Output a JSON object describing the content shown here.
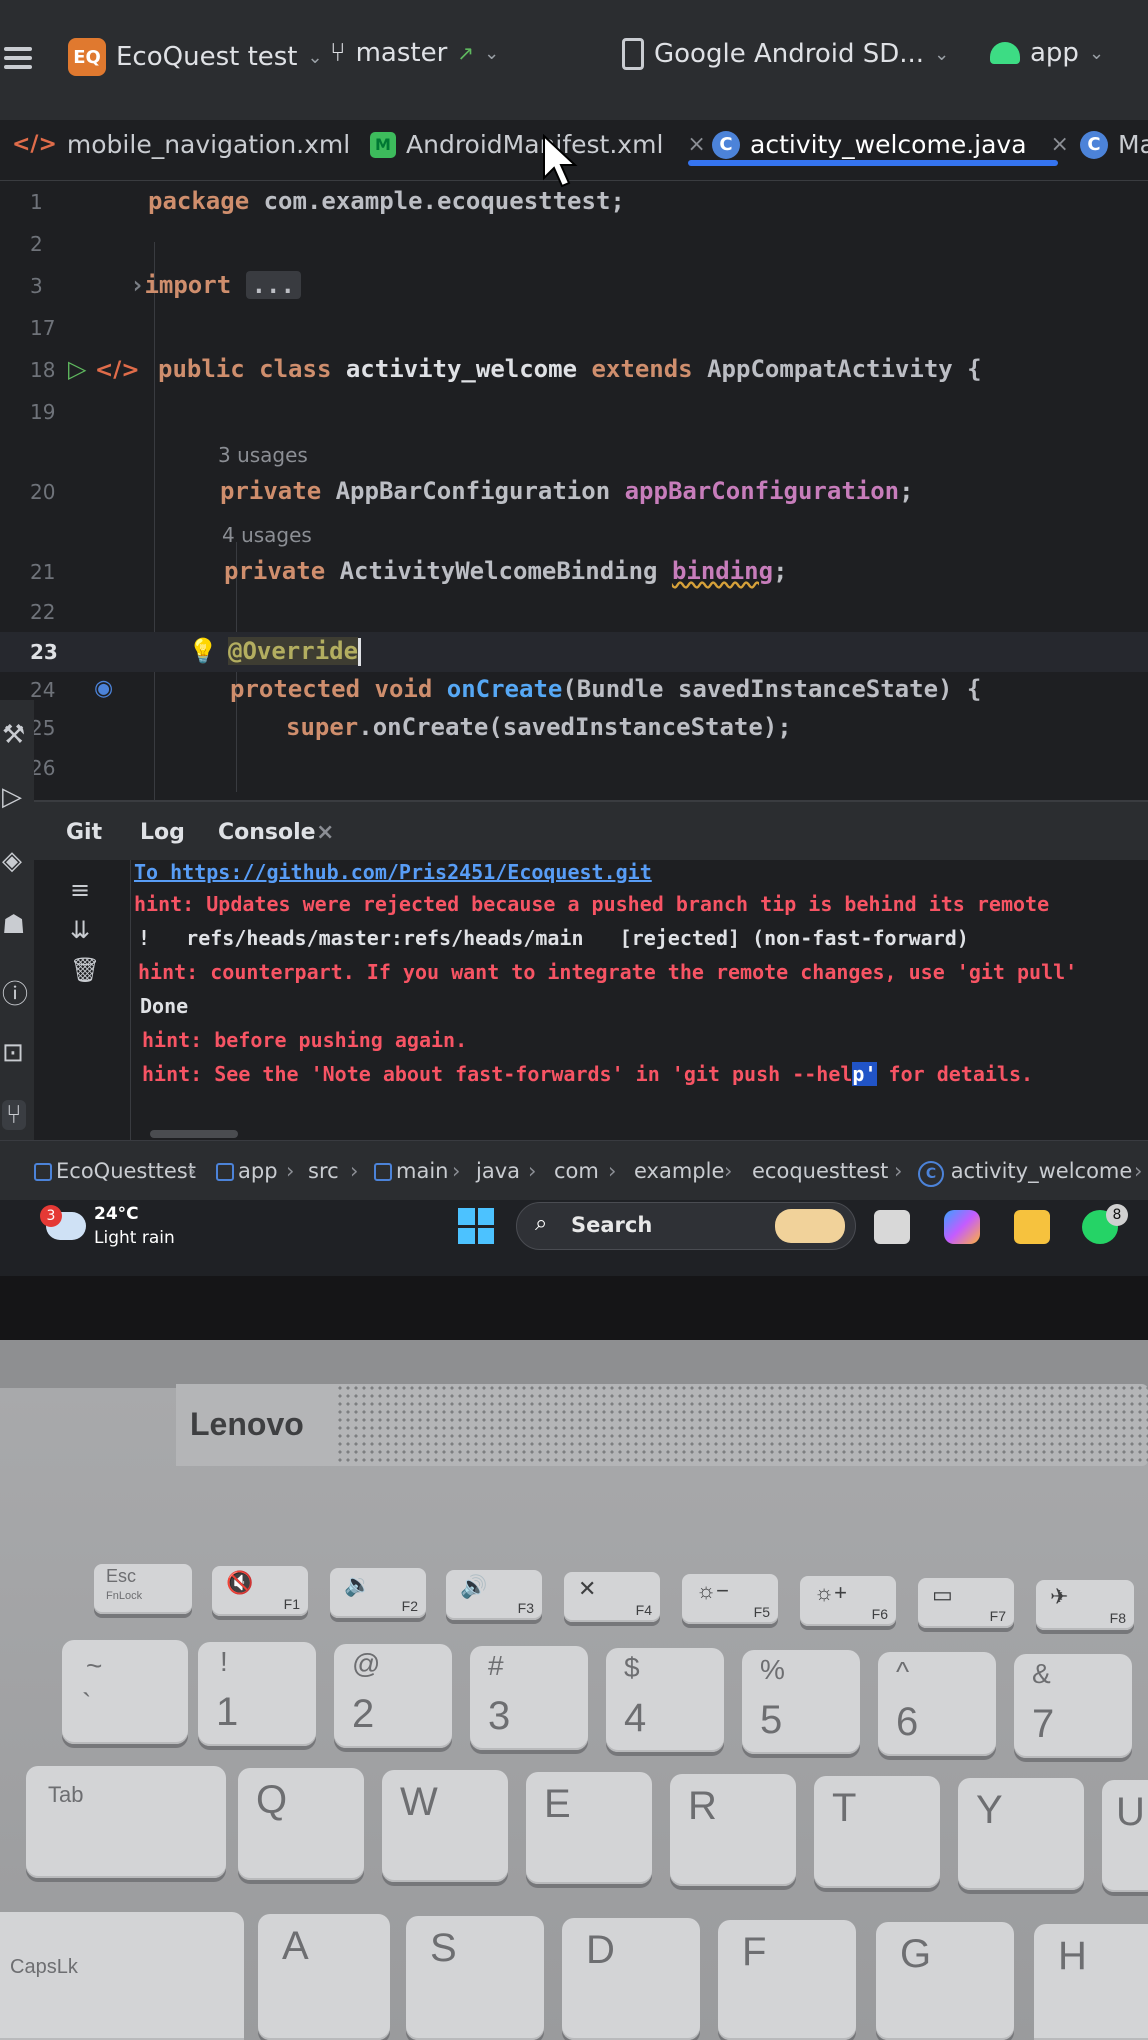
{
  "toolbar": {
    "project_badge": "EQ",
    "project_name": "EcoQuest test",
    "branch": "master",
    "device": "Google Android SD...",
    "run_config": "app"
  },
  "tabs": [
    {
      "label": "mobile_navigation.xml"
    },
    {
      "label": "AndroidManifest.xml",
      "close": "×"
    },
    {
      "label": "activity_welcome.java",
      "close": "×",
      "active": true
    },
    {
      "label": "Ma"
    }
  ],
  "editor": {
    "lines": [
      {
        "n": "1",
        "parts": [
          "package",
          " com.example.ecoquesttest;"
        ]
      },
      {
        "n": "2"
      },
      {
        "n": "3",
        "parts": [
          "import",
          "..."
        ]
      },
      {
        "n": "17"
      },
      {
        "n": "18",
        "parts": [
          "public class",
          " activity_welcome ",
          "extends",
          " AppCompatActivity {"
        ]
      },
      {
        "n": "19"
      },
      {
        "usage": "3 usages"
      },
      {
        "n": "20",
        "parts": [
          "private",
          " AppBarConfiguration ",
          "appBarConfiguration",
          ";"
        ]
      },
      {
        "usage": "4 usages"
      },
      {
        "n": "21",
        "parts": [
          "private",
          " ActivityWelcomeBinding ",
          "binding",
          ";"
        ]
      },
      {
        "n": "22"
      },
      {
        "n": "23",
        "parts": [
          "@Override"
        ]
      },
      {
        "n": "24",
        "parts": [
          "protected void",
          " onCreate",
          "(Bundle savedInstanceState) {"
        ]
      },
      {
        "n": "25",
        "parts": [
          "super",
          ".onCreate(savedInstanceState);"
        ]
      },
      {
        "n": "26"
      }
    ]
  },
  "toolwindow": {
    "tabs": [
      "Git",
      "Log",
      "Console"
    ],
    "close": "×",
    "console": [
      {
        "text": "To https://github.com/Pris2451/Ecoquest.git",
        "style": "link"
      },
      {
        "text": "hint: Updates were rejected because a pushed branch tip is behind its remote",
        "style": "red"
      },
      {
        "text": "!   refs/heads/master:refs/heads/main   [rejected] (non-fast-forward)",
        "style": "white"
      },
      {
        "text": "hint: counterpart. If you want to integrate the remote changes, use 'git pull'",
        "style": "red"
      },
      {
        "text": "Done",
        "style": "white"
      },
      {
        "text": "hint: before pushing again.",
        "style": "red"
      },
      {
        "text_before": "hint: See the 'Note about fast-forwards' in 'git push --hel",
        "selected": "p'",
        "text_after": " for details.",
        "style": "red"
      }
    ]
  },
  "breadcrumb": [
    "EcoQuesttest",
    "app",
    "src",
    "main",
    "java",
    "com",
    "example",
    "ecoquesttest",
    "activity_welcome"
  ],
  "taskbar": {
    "weather_badge": "3",
    "temperature": "24°C",
    "condition": "Light rain",
    "search_label": "Search",
    "whatsapp_badge": "8"
  },
  "laptop": {
    "brand": "Lenovo"
  },
  "keyboard": {
    "fn_row": [
      {
        "main": "Esc",
        "sub": "FnLock"
      },
      {
        "f": "F1"
      },
      {
        "f": "F2"
      },
      {
        "f": "F3"
      },
      {
        "f": "F4"
      },
      {
        "f": "F5"
      },
      {
        "f": "F6"
      },
      {
        "f": "F7"
      },
      {
        "f": "F8"
      }
    ],
    "num_row": [
      {
        "shift": "~",
        "main": "`"
      },
      {
        "shift": "!",
        "main": "1"
      },
      {
        "shift": "@",
        "main": "2"
      },
      {
        "shift": "#",
        "main": "3"
      },
      {
        "shift": "$",
        "main": "4"
      },
      {
        "shift": "%",
        "main": "5"
      },
      {
        "shift": "^",
        "main": "6"
      },
      {
        "shift": "&",
        "main": "7"
      }
    ],
    "top_row": [
      "Tab",
      "Q",
      "W",
      "E",
      "R",
      "T",
      "Y",
      "U"
    ],
    "home_row": [
      "CapsLk",
      "A",
      "S",
      "D",
      "F",
      "G",
      "H"
    ]
  }
}
